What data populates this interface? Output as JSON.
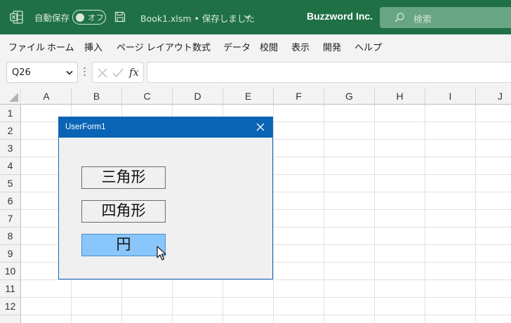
{
  "titlebar": {
    "autosave_label": "自動保存",
    "toggle_text": "オフ",
    "filename": "Book1.xlsm • 保存しました",
    "company": "Buzzword Inc.",
    "search_placeholder": "検索",
    "colors": {
      "background": "#1f7145",
      "search_bg": "#67a584"
    }
  },
  "menu": {
    "items": [
      "ファイル",
      "ホーム",
      "挿入",
      "ページ レイアウト",
      "数式",
      "データ",
      "校閲",
      "表示",
      "開発",
      "ヘルプ"
    ]
  },
  "formula_bar": {
    "name_box": "Q26",
    "fx_label": "fx",
    "formula": ""
  },
  "sheet": {
    "columns": [
      "A",
      "B",
      "C",
      "D",
      "E",
      "F",
      "G",
      "H",
      "I",
      "J"
    ],
    "rows": [
      "1",
      "2",
      "3",
      "4",
      "5",
      "6",
      "7",
      "8",
      "9",
      "10",
      "11",
      "12"
    ]
  },
  "userform": {
    "title": "UserForm1",
    "buttons": [
      "三角形",
      "四角形",
      "円"
    ],
    "hovered_button": "円",
    "colors": {
      "title_bg": "#0a64b5",
      "hover_bg": "#88c6fb"
    }
  }
}
